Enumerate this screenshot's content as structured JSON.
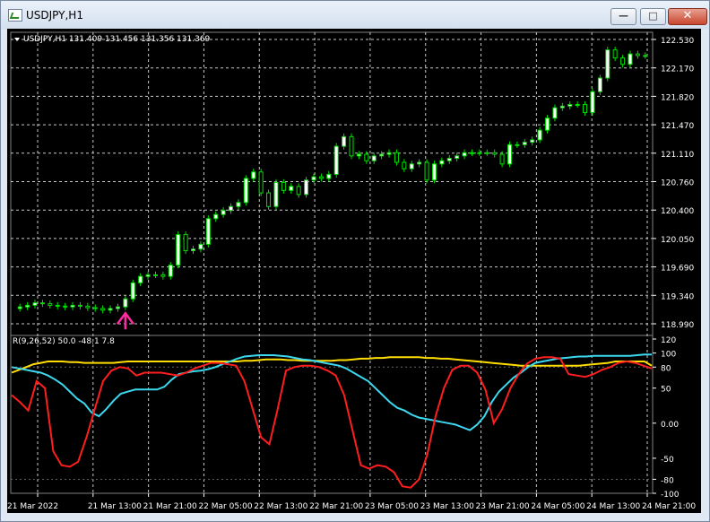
{
  "window": {
    "title": "USDJPY,H1",
    "min_glyph": "—",
    "max_glyph": "□",
    "close_glyph": "✕"
  },
  "colors": {
    "background": "#000000",
    "grid": "#c8c8c8",
    "bull": "#00e000",
    "bull_body": "#ffffff",
    "axis_text": "#ffffff",
    "rsi": "#ff1e1e",
    "cyan": "#3cd8f0",
    "yellow": "#ffdd00",
    "arrow": "#ff2aa0"
  },
  "chart_data": [
    {
      "type": "candlestick",
      "title": "USDJPY,H1  131.409 131.456 131.356 131.369",
      "series_label": "USDJPY,H1",
      "ohlc_text": "131.409 131.456 131.356 131.369",
      "ylim": [
        118.99,
        122.53
      ],
      "yticks": [
        "122.530",
        "122.170",
        "121.820",
        "121.470",
        "121.110",
        "120.760",
        "120.400",
        "120.050",
        "119.690",
        "119.340",
        "118.990"
      ],
      "xticks": [
        "21 Mar 2022",
        "21 Mar 13:00",
        "21 Mar 21:00",
        "22 Mar 05:00",
        "22 Mar 13:00",
        "22 Mar 21:00",
        "23 Mar 05:00",
        "23 Mar 13:00",
        "23 Mar 21:00",
        "24 Mar 05:00",
        "24 Mar 13:00",
        "24 Mar 21:00"
      ],
      "grid": true,
      "close": [
        119.2,
        119.22,
        119.25,
        119.24,
        119.22,
        119.21,
        119.2,
        119.22,
        119.21,
        119.19,
        119.18,
        119.16,
        119.18,
        119.2,
        119.3,
        119.5,
        119.58,
        119.6,
        119.6,
        119.58,
        119.72,
        120.1,
        119.9,
        119.92,
        119.98,
        120.3,
        120.35,
        120.4,
        120.45,
        120.5,
        120.8,
        120.88,
        120.62,
        120.45,
        120.75,
        120.65,
        120.7,
        120.6,
        120.78,
        120.82,
        120.8,
        120.85,
        121.2,
        121.32,
        121.08,
        121.1,
        121.02,
        121.08,
        121.1,
        121.12,
        121.0,
        120.92,
        120.98,
        121.0,
        120.78,
        120.98,
        121.02,
        121.05,
        121.08,
        121.12,
        121.12,
        121.12,
        121.12,
        121.1,
        120.98,
        121.22,
        121.22,
        121.25,
        121.28,
        121.4,
        121.55,
        121.68,
        121.7,
        121.72,
        121.72,
        121.62,
        121.88,
        122.05,
        122.4,
        122.3,
        122.22,
        122.35,
        122.33,
        122.33
      ],
      "annotation": "buy-arrow"
    },
    {
      "type": "line",
      "title": "R(9,26,52) 50.0 -48.1 7.8",
      "ylim": [
        -100,
        120
      ],
      "yticks": [
        "120",
        "100",
        "80",
        "50",
        "0.00",
        "-50",
        "-80",
        "-100"
      ],
      "series": [
        {
          "name": "50.0",
          "color": "#ffdd00",
          "values": [
            72,
            76,
            80,
            84,
            86,
            88,
            88,
            88,
            87,
            87,
            86,
            86,
            86,
            86,
            86,
            87,
            88,
            88,
            88,
            88,
            88,
            88,
            88,
            88,
            88,
            88,
            88,
            88,
            88,
            88,
            88,
            88,
            89,
            89,
            90,
            91,
            91,
            91,
            90,
            90,
            89,
            89,
            89,
            89,
            89,
            90,
            90,
            91,
            92,
            92,
            93,
            93,
            94,
            94,
            94,
            94,
            94,
            93,
            93,
            92,
            92,
            91,
            90,
            89,
            88,
            87,
            86,
            85,
            84,
            83,
            82,
            82,
            82,
            82,
            82,
            82,
            82,
            82,
            82,
            83,
            84,
            85,
            86,
            88,
            88,
            88,
            88,
            88,
            82
          ]
        },
        {
          "name": "-48.1",
          "color": "#3cd8f0",
          "values": [
            80,
            78,
            76,
            74,
            72,
            68,
            62,
            55,
            45,
            35,
            28,
            15,
            10,
            20,
            32,
            42,
            45,
            48,
            48,
            48,
            48,
            52,
            62,
            70,
            72,
            74,
            75,
            77,
            80,
            84,
            88,
            92,
            95,
            96,
            97,
            97,
            97,
            96,
            95,
            93,
            91,
            90,
            88,
            86,
            84,
            82,
            78,
            72,
            66,
            60,
            50,
            40,
            30,
            22,
            18,
            12,
            8,
            6,
            4,
            2,
            0,
            -2,
            -6,
            -10,
            -2,
            10,
            30,
            45,
            55,
            65,
            72,
            80,
            86,
            88,
            90,
            92,
            93,
            94,
            95,
            95,
            96,
            96,
            96,
            96,
            96,
            96,
            97,
            98,
            98
          ]
        },
        {
          "name": "7.8",
          "color": "#ff1e1e",
          "values": [
            40,
            30,
            18,
            60,
            50,
            -40,
            -60,
            -62,
            -55,
            -20,
            20,
            60,
            75,
            80,
            78,
            68,
            72,
            72,
            72,
            70,
            68,
            72,
            78,
            82,
            86,
            86,
            84,
            82,
            60,
            20,
            -20,
            -30,
            20,
            75,
            80,
            82,
            82,
            80,
            75,
            68,
            40,
            -10,
            -60,
            -65,
            -60,
            -62,
            -70,
            -90,
            -92,
            -80,
            -45,
            10,
            50,
            76,
            82,
            82,
            72,
            48,
            0,
            20,
            50,
            70,
            85,
            92,
            94,
            94,
            92,
            70,
            68,
            66,
            70,
            76,
            80,
            86,
            88,
            86,
            82,
            78
          ]
        }
      ]
    }
  ]
}
